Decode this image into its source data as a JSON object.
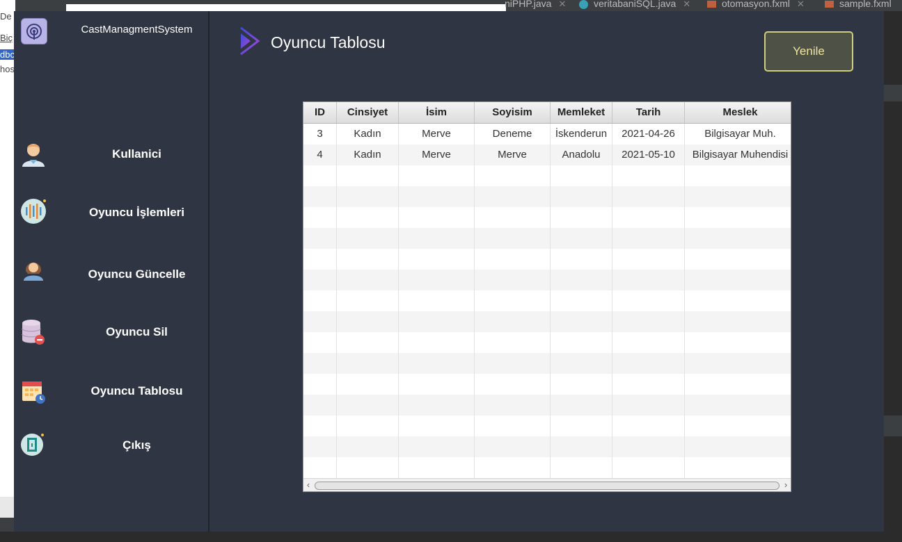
{
  "background": {
    "left_lines": [
      "De",
      "Biç",
      "dbc",
      "host"
    ],
    "tabs": [
      {
        "label": "niPHP.java",
        "icon": "java-class-icon"
      },
      {
        "label": "veritabaniSQL.java",
        "icon": "java-class-icon"
      },
      {
        "label": "otomasyon.fxml",
        "icon": "fxml-file-icon"
      },
      {
        "label": "sample.fxml",
        "icon": "fxml-file-icon"
      }
    ]
  },
  "app": {
    "title": "CastManagmentSystem"
  },
  "menu": {
    "items": [
      {
        "label": "Kullanici",
        "icon": "user-icon"
      },
      {
        "label": "Oyuncu İşlemleri",
        "icon": "equalizer-icon"
      },
      {
        "label": "Oyuncu Güncelle",
        "icon": "actor-woman-icon"
      },
      {
        "label": "Oyuncu Sil",
        "icon": "database-delete-icon"
      },
      {
        "label": "Oyuncu Tablosu",
        "icon": "calendar-clock-icon"
      },
      {
        "label": "Çıkış",
        "icon": "exit-door-icon"
      }
    ]
  },
  "page": {
    "title": "Oyuncu Tablosu",
    "refresh_label": "Yenile"
  },
  "table": {
    "columns": [
      "ID",
      "Cinsiyet",
      "İsim",
      "Soyisim",
      "Memleket",
      "Tarih",
      "Meslek"
    ],
    "rows": [
      [
        "3",
        "Kadın",
        "Merve",
        "Deneme",
        "İskenderun",
        "2021-04-26",
        "Bilgisayar Muh."
      ],
      [
        "4",
        "Kadın",
        "Merve",
        "Merve",
        "Anadolu",
        "2021-05-10",
        "Bilgisayar Muhendisi"
      ]
    ]
  },
  "colors": {
    "app_bg": "#2f3542",
    "refresh_border": "#d0cf7e",
    "refresh_text": "#efe6a0",
    "page_icon_gradient": [
      "#3b4bd6",
      "#a24ad8"
    ]
  }
}
